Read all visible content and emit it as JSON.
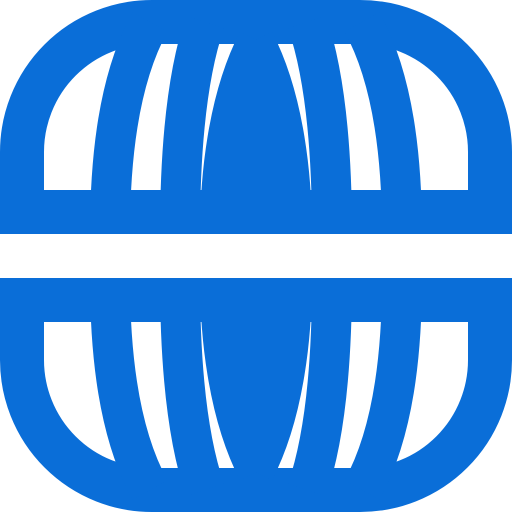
{
  "logo": {
    "icon": "globe-grid-icon",
    "color": "#0A6ED8",
    "background": "#FFFFFF"
  }
}
